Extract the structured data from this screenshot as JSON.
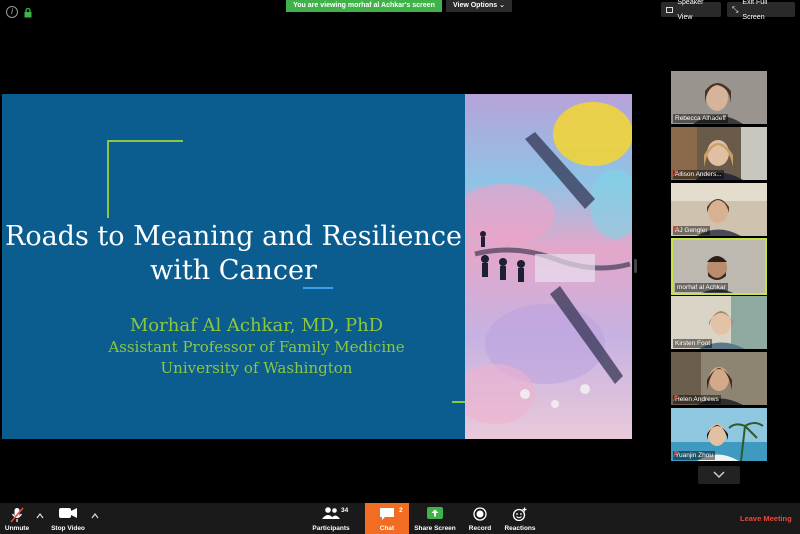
{
  "banner": {
    "text": "You are viewing morhaf al Achkar's screen"
  },
  "view_options": {
    "label": "View Options"
  },
  "top_buttons": {
    "speaker_view": "Speaker View",
    "exit_full_screen": "Exit Full Screen"
  },
  "slide": {
    "title_line1": "Roads to Meaning and Resilience",
    "title_line2": "with Cancer",
    "speaker_name": "Morhaf Al Achkar, MD, PhD",
    "speaker_role_line1": "Assistant Professor of Family Medicine",
    "speaker_role_line2": "University of Washington"
  },
  "participants": [
    {
      "name": "Rebecca Alhadeff",
      "muted": false,
      "active": false
    },
    {
      "name": "Allison Anders...",
      "muted": true,
      "active": false
    },
    {
      "name": "AJ Gengler",
      "muted": true,
      "active": false
    },
    {
      "name": "morhaf al Achkar",
      "muted": false,
      "active": true
    },
    {
      "name": "Kirsten Foot",
      "muted": false,
      "active": false
    },
    {
      "name": "Helen Andrews",
      "muted": true,
      "active": false
    },
    {
      "name": "Yuanjin Zhou",
      "muted": true,
      "active": false
    }
  ],
  "toolbar": {
    "unmute": "Unmute",
    "stop_video": "Stop Video",
    "participants": "Participants",
    "participants_count": "34",
    "chat": "Chat",
    "chat_count": "2",
    "share_screen": "Share Screen",
    "record": "Record",
    "reactions": "Reactions",
    "leave": "Leave Meeting"
  },
  "colors": {
    "share_banner": "#3fb24a",
    "slide_blue": "#0b5d8f",
    "accent_green": "#8dc63f",
    "chat_orange": "#f26d21",
    "leave_red": "#e8493a",
    "active_speaker": "#c7e34a"
  }
}
